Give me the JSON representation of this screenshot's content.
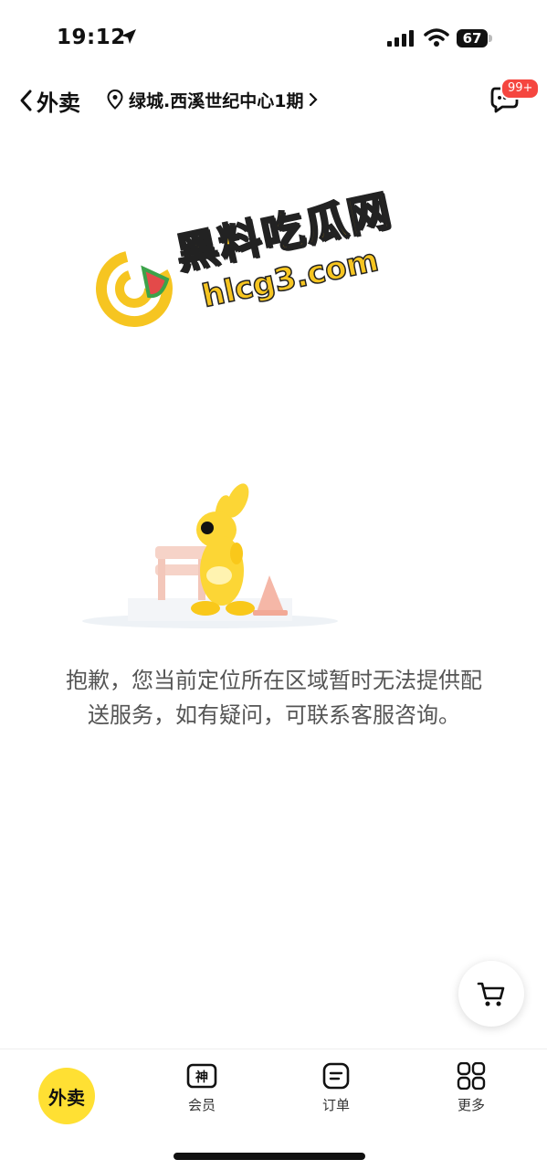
{
  "status_bar": {
    "time": "19:12",
    "battery": "67"
  },
  "nav": {
    "back_title": "外卖",
    "address": "绿城.西溪世纪中心1期",
    "message_badge": "99+"
  },
  "watermark": {
    "title": "黑料吃瓜网",
    "url": "hlcg3.com"
  },
  "main": {
    "message_line1": "抱歉，您当前定位所在区域暂时无法提供配",
    "message_line2": "送服务，如有疑问，可联系客服咨询。"
  },
  "tabs": [
    {
      "label": "外卖",
      "active": true
    },
    {
      "label": "会员",
      "icon": "member-icon"
    },
    {
      "label": "订单",
      "icon": "order-icon"
    },
    {
      "label": "更多",
      "icon": "grid-icon"
    }
  ],
  "colors": {
    "accent": "#ffe033",
    "badge": "#f5463f"
  }
}
